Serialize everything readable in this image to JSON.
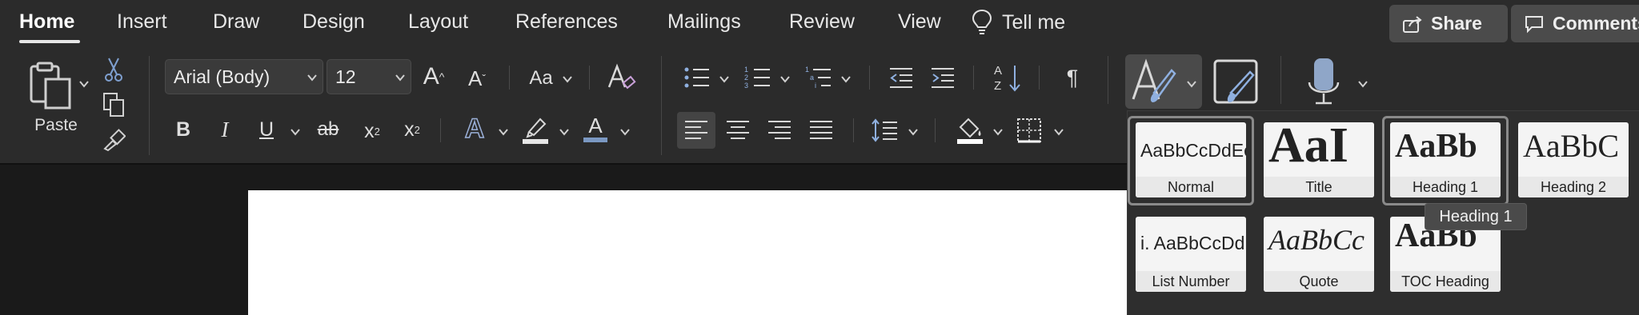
{
  "tabs": [
    {
      "label": "Home",
      "active": true
    },
    {
      "label": "Insert"
    },
    {
      "label": "Draw"
    },
    {
      "label": "Design"
    },
    {
      "label": "Layout"
    },
    {
      "label": "References"
    },
    {
      "label": "Mailings"
    },
    {
      "label": "Review"
    },
    {
      "label": "View"
    }
  ],
  "tell_me": "Tell me",
  "share": {
    "label": "Share",
    "icon": "share-icon"
  },
  "comments": {
    "label": "Comments",
    "icon": "comment-icon"
  },
  "clipboard": {
    "paste_label": "Paste"
  },
  "font": {
    "family": "Arial (Body)",
    "size": "12",
    "grow_label": "A",
    "shrink_label": "A",
    "change_case_label": "Aa",
    "bold": "B",
    "italic": "I",
    "underline": "U",
    "strike": "ab",
    "subscript": "x",
    "subscript_sub": "2",
    "superscript": "x",
    "superscript_sup": "2",
    "text_effects": "A",
    "font_color": "A",
    "highlight_color": "#e6e6e6",
    "font_color_bar": "#7b98c2"
  },
  "paragraph": {
    "pilcrow": "¶",
    "sort_a": "A",
    "sort_z": "Z"
  },
  "styles": {
    "gallery": [
      {
        "sample": "AaBbCcDdEe",
        "name": "Normal"
      },
      {
        "sample": "AaI",
        "name": "Title"
      },
      {
        "sample": "AaBb",
        "name": "Heading 1"
      },
      {
        "sample": "AaBbC",
        "name": "Heading 2"
      },
      {
        "sample": "i.  AaBbCcDd",
        "name": "List Number"
      },
      {
        "sample": "AaBbCc",
        "name": "Quote"
      },
      {
        "sample": "AaBb",
        "name": "TOC Heading"
      }
    ],
    "tooltip": "Heading 1"
  }
}
